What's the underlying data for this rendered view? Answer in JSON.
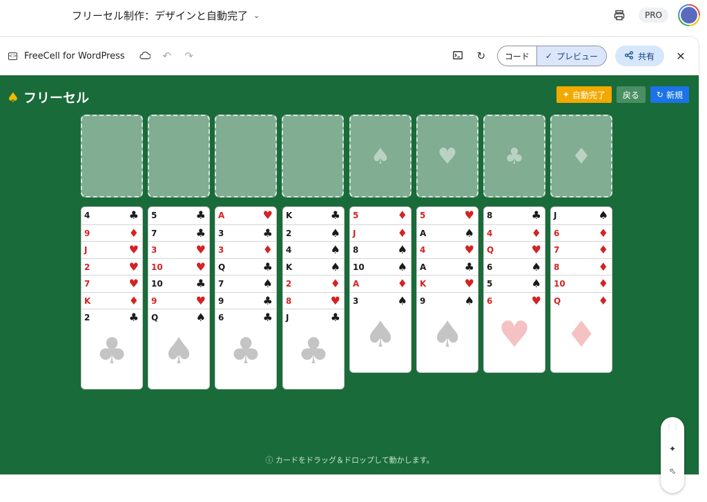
{
  "appbar": {
    "title": "フリーセル制作：デザインと自動完了",
    "pro_label": "PRO",
    "icons": [
      "chevron-down-icon",
      "printer-icon",
      "avatar"
    ]
  },
  "toolbar": {
    "doc_name": "FreeCell for WordPress",
    "code_label": "コード",
    "preview_label": "プレビュー",
    "share_label": "共有",
    "icons": [
      "code-window-icon",
      "cloud-icon",
      "undo-icon",
      "redo-icon",
      "terminal-icon",
      "refresh-icon",
      "check-icon",
      "share-icon",
      "close-icon"
    ]
  },
  "game": {
    "title": "フリーセル",
    "auto_label": "自動完了",
    "undo_label": "戻る",
    "new_label": "新規",
    "hint": "カードをドラッグ＆ドロップして動かします。",
    "foundation_suits": [
      "♠",
      "♥",
      "♣",
      "♦"
    ],
    "colors": {
      "felt": "#1a6b3a",
      "auto": "#f2a900",
      "new": "#1a73e8",
      "red": "#d42323"
    },
    "columns": [
      [
        [
          "4",
          "♣"
        ],
        [
          "9",
          "♦"
        ],
        [
          "J",
          "♥"
        ],
        [
          "2",
          "♥"
        ],
        [
          "7",
          "♥"
        ],
        [
          "K",
          "♦"
        ],
        [
          "2",
          "♣"
        ]
      ],
      [
        [
          "5",
          "♣"
        ],
        [
          "7",
          "♣"
        ],
        [
          "3",
          "♥"
        ],
        [
          "10",
          "♥"
        ],
        [
          "10",
          "♣"
        ],
        [
          "9",
          "♥"
        ],
        [
          "Q",
          "♠"
        ]
      ],
      [
        [
          "A",
          "♥"
        ],
        [
          "3",
          "♣"
        ],
        [
          "3",
          "♦"
        ],
        [
          "Q",
          "♣"
        ],
        [
          "7",
          "♠"
        ],
        [
          "9",
          "♣"
        ],
        [
          "6",
          "♣"
        ]
      ],
      [
        [
          "K",
          "♣"
        ],
        [
          "2",
          "♠"
        ],
        [
          "4",
          "♠"
        ],
        [
          "K",
          "♠"
        ],
        [
          "2",
          "♦"
        ],
        [
          "8",
          "♥"
        ],
        [
          "J",
          "♣"
        ]
      ],
      [
        [
          "5",
          "♦"
        ],
        [
          "J",
          "♦"
        ],
        [
          "8",
          "♠"
        ],
        [
          "10",
          "♠"
        ],
        [
          "A",
          "♦"
        ],
        [
          "3",
          "♠"
        ]
      ],
      [
        [
          "5",
          "♥"
        ],
        [
          "A",
          "♠"
        ],
        [
          "4",
          "♥"
        ],
        [
          "A",
          "♣"
        ],
        [
          "K",
          "♥"
        ],
        [
          "9",
          "♠"
        ]
      ],
      [
        [
          "8",
          "♣"
        ],
        [
          "4",
          "♦"
        ],
        [
          "Q",
          "♥"
        ],
        [
          "6",
          "♠"
        ],
        [
          "5",
          "♠"
        ],
        [
          "6",
          "♥"
        ]
      ],
      [
        [
          "J",
          "♠"
        ],
        [
          "6",
          "♦"
        ],
        [
          "7",
          "♦"
        ],
        [
          "8",
          "♦"
        ],
        [
          "10",
          "♦"
        ],
        [
          "Q",
          "♦"
        ]
      ]
    ]
  }
}
